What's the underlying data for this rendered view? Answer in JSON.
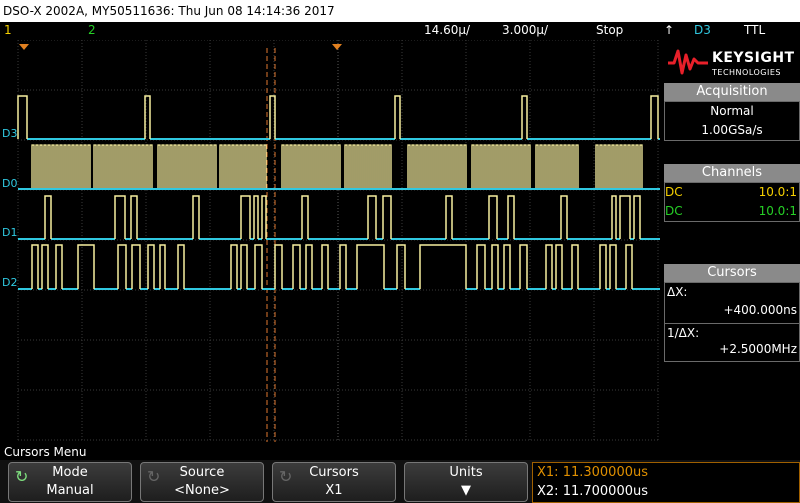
{
  "title": "DSO-X 2002A, MY50511636: Thu Jun 08 14:14:36 2017",
  "status": {
    "ch1": "1",
    "ch2": "2",
    "timebase": "14.60µ/",
    "delay": "3.000µ/",
    "run_state": "Stop",
    "trigger_icon": "↑",
    "trigger_source": "D3",
    "trigger_type": "TTL"
  },
  "logo": {
    "word": "KEYSIGHT",
    "sub": "TECHNOLOGIES"
  },
  "acquisition": {
    "header": "Acquisition",
    "mode": "Normal",
    "rate": "1.00GSa/s"
  },
  "channels": {
    "header": "Channels",
    "rows": [
      {
        "coupling": "DC",
        "value": "10.0:1",
        "color": "#f5d000"
      },
      {
        "coupling": "DC",
        "value": "10.0:1",
        "color": "#26d026"
      }
    ]
  },
  "cursors": {
    "header": "Cursors",
    "dx_label": "ΔX:",
    "dx_value": "+400.000ns",
    "inv_label": "1/ΔX:",
    "inv_value": "+2.5000MHz"
  },
  "menu_title": "Cursors Menu",
  "softkeys": [
    {
      "l1": "Mode",
      "l2": "Manual",
      "icon": "cycle-icon"
    },
    {
      "l1": "Source",
      "l2": "<None>",
      "icon": "cycle-icon"
    },
    {
      "l1": "Cursors",
      "l2": "X1",
      "icon": "cycle-icon"
    },
    {
      "l1": "Units",
      "l2": "▼",
      "icon": ""
    }
  ],
  "x_readout": {
    "x1": "X1: 11.300000us",
    "x2": "X2: 11.700000us"
  },
  "digital_labels": [
    "D3",
    "D0",
    "D1",
    "D2"
  ],
  "colors": {
    "digital_high": "#f8f0a0",
    "digital_low": "#30c8e0",
    "cursor": "#e07830"
  }
}
